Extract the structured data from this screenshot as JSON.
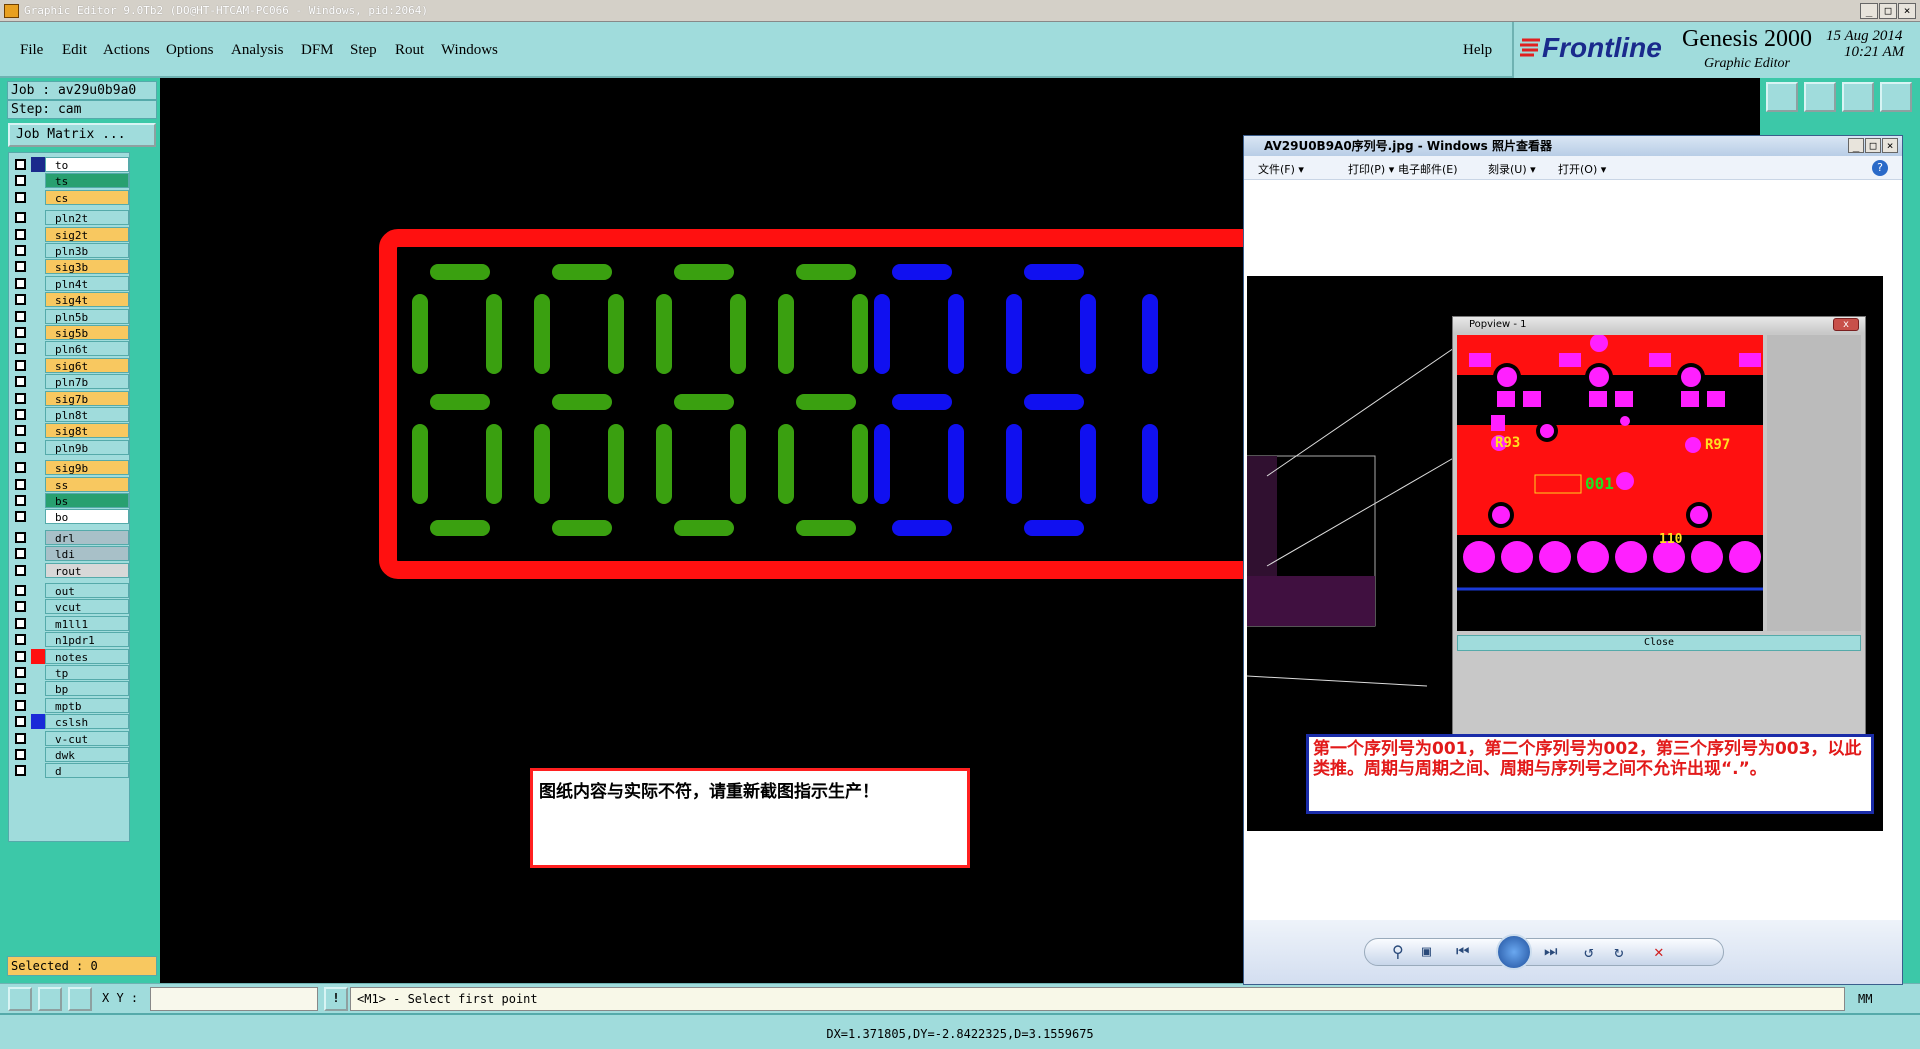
{
  "window": {
    "title": "Graphic Editor 9.0Tb2 (DO@HT-HTCAM-PC066 - Windows, pid:2064)"
  },
  "menu": {
    "file": "File",
    "edit": "Edit",
    "actions": "Actions",
    "options": "Options",
    "analysis": "Analysis",
    "dfm": "DFM",
    "step": "Step",
    "rout": "Rout",
    "windows": "Windows",
    "help": "Help"
  },
  "brand": {
    "logo": "Frontline",
    "product": "Genesis 2000",
    "subtitle": "Graphic Editor",
    "date": "15 Aug 2014",
    "time": "10:21 AM"
  },
  "job": {
    "job_line": "Job : av29u0b9a0",
    "step_line": "Step: cam",
    "matrix_button": "Job Matrix ..."
  },
  "layers": [
    {
      "name": "to",
      "color": "#ffffff"
    },
    {
      "name": "ts",
      "color": "#28a070"
    },
    {
      "name": "cs",
      "color": "#f8c860"
    },
    {
      "name": "pln2t",
      "color": "#a0dcdc"
    },
    {
      "name": "sig2t",
      "color": "#f8c860"
    },
    {
      "name": "pln3b",
      "color": "#a0dcdc"
    },
    {
      "name": "sig3b",
      "color": "#f8c860"
    },
    {
      "name": "pln4t",
      "color": "#a0dcdc"
    },
    {
      "name": "sig4t",
      "color": "#f8c860"
    },
    {
      "name": "pln5b",
      "color": "#a0dcdc"
    },
    {
      "name": "sig5b",
      "color": "#f8c860"
    },
    {
      "name": "pln6t",
      "color": "#a0dcdc"
    },
    {
      "name": "sig6t",
      "color": "#f8c860"
    },
    {
      "name": "pln7b",
      "color": "#a0dcdc"
    },
    {
      "name": "sig7b",
      "color": "#f8c860"
    },
    {
      "name": "pln8t",
      "color": "#a0dcdc"
    },
    {
      "name": "sig8t",
      "color": "#f8c860"
    },
    {
      "name": "pln9b",
      "color": "#a0dcdc"
    },
    {
      "name": "sig9b",
      "color": "#f8c860"
    },
    {
      "name": "ss",
      "color": "#f8c860"
    },
    {
      "name": "bs",
      "color": "#28a070"
    },
    {
      "name": "bo",
      "color": "#ffffff"
    },
    {
      "name": "drl",
      "color": "#a8c0c8"
    },
    {
      "name": "ldi",
      "color": "#a8c0c8"
    },
    {
      "name": "rout",
      "color": "#d8d8d8"
    },
    {
      "name": "out",
      "color": "#a0dcdc"
    },
    {
      "name": "vcut",
      "color": "#a0dcdc"
    },
    {
      "name": "m1ll1",
      "color": "#a0dcdc"
    },
    {
      "name": "n1pdr1",
      "color": "#a0dcdc"
    },
    {
      "name": "notes",
      "color": "#a0dcdc"
    },
    {
      "name": "tp",
      "color": "#a0dcdc"
    },
    {
      "name": "bp",
      "color": "#a0dcdc"
    },
    {
      "name": "mptb",
      "color": "#a0dcdc"
    },
    {
      "name": "cslsh",
      "color": "#a0dcdc"
    },
    {
      "name": "v-cut",
      "color": "#a0dcdc"
    },
    {
      "name": "dwk",
      "color": "#a0dcdc"
    },
    {
      "name": "d",
      "color": "#a0dcdc"
    }
  ],
  "selected": "Selected : 0",
  "xy_label": "X Y :",
  "prompt": "<M1> - Select first point",
  "unit": "MM",
  "status": "DX=1.371805,DY=-2.8422325,D=3.1559675",
  "canvas_note": "图纸内容与实际不符，请重新截图指示生产！",
  "viewer": {
    "title": "AV29U0B9A0序列号.jpg - Windows 照片查看器",
    "menu": [
      "文件(F) ▾",
      "打印(P) ▾",
      "电子邮件(E)",
      "刻录(U) ▾",
      "打开(O) ▾"
    ],
    "popview_title": "Popview - 1",
    "close_label": "Close",
    "labels": {
      "r93": "R93",
      "r97": "R97",
      "serial": "001",
      "code": "110"
    },
    "note": "第一个序列号为001，第二个序列号为002，第三个序列号为003，以此类推。周期与周期之间、周期与序列号之间不允许出现“.”。"
  }
}
